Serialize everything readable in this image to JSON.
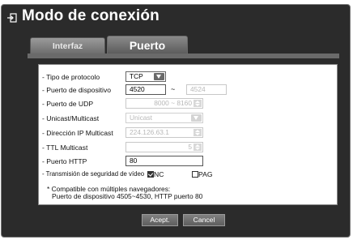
{
  "window": {
    "title": "Modo de conexión",
    "icon": "enter-icon"
  },
  "tabs": [
    {
      "label": "Interfaz",
      "active": false
    },
    {
      "label": "Puerto",
      "active": true
    }
  ],
  "form": {
    "protocol": {
      "label": "- Tipo de protocolo",
      "value": "TCP"
    },
    "device_port": {
      "label": "- Puerto de dispositivo",
      "start": "4520",
      "separator": "~",
      "end": "4524"
    },
    "udp_port": {
      "label": "- Puerto de UDP",
      "value": "8000 ~ 8160"
    },
    "unicast_multicast": {
      "label": "- Unicast/Multicast",
      "value": "Unicast"
    },
    "multicast_ip": {
      "label": "- Dirección IP Multicast",
      "value": "224.126.63.1"
    },
    "ttl_multicast": {
      "label": "- TTL Multicast",
      "value": "5"
    },
    "http_port": {
      "label": "- Puerto HTTP",
      "value": "80"
    },
    "video_security": {
      "label": "- Transmisión de seguridad de vídeo",
      "options": [
        {
          "label": "NC",
          "checked": true
        },
        {
          "label": "PAG",
          "checked": false
        }
      ]
    },
    "note_line1": "* Compatible con múltiples navegadores:",
    "note_line2": "Puerto de dispositivo 4505~4530, HTTP puerto 80"
  },
  "buttons": {
    "ok": "Acept.",
    "cancel": "Cancel"
  }
}
